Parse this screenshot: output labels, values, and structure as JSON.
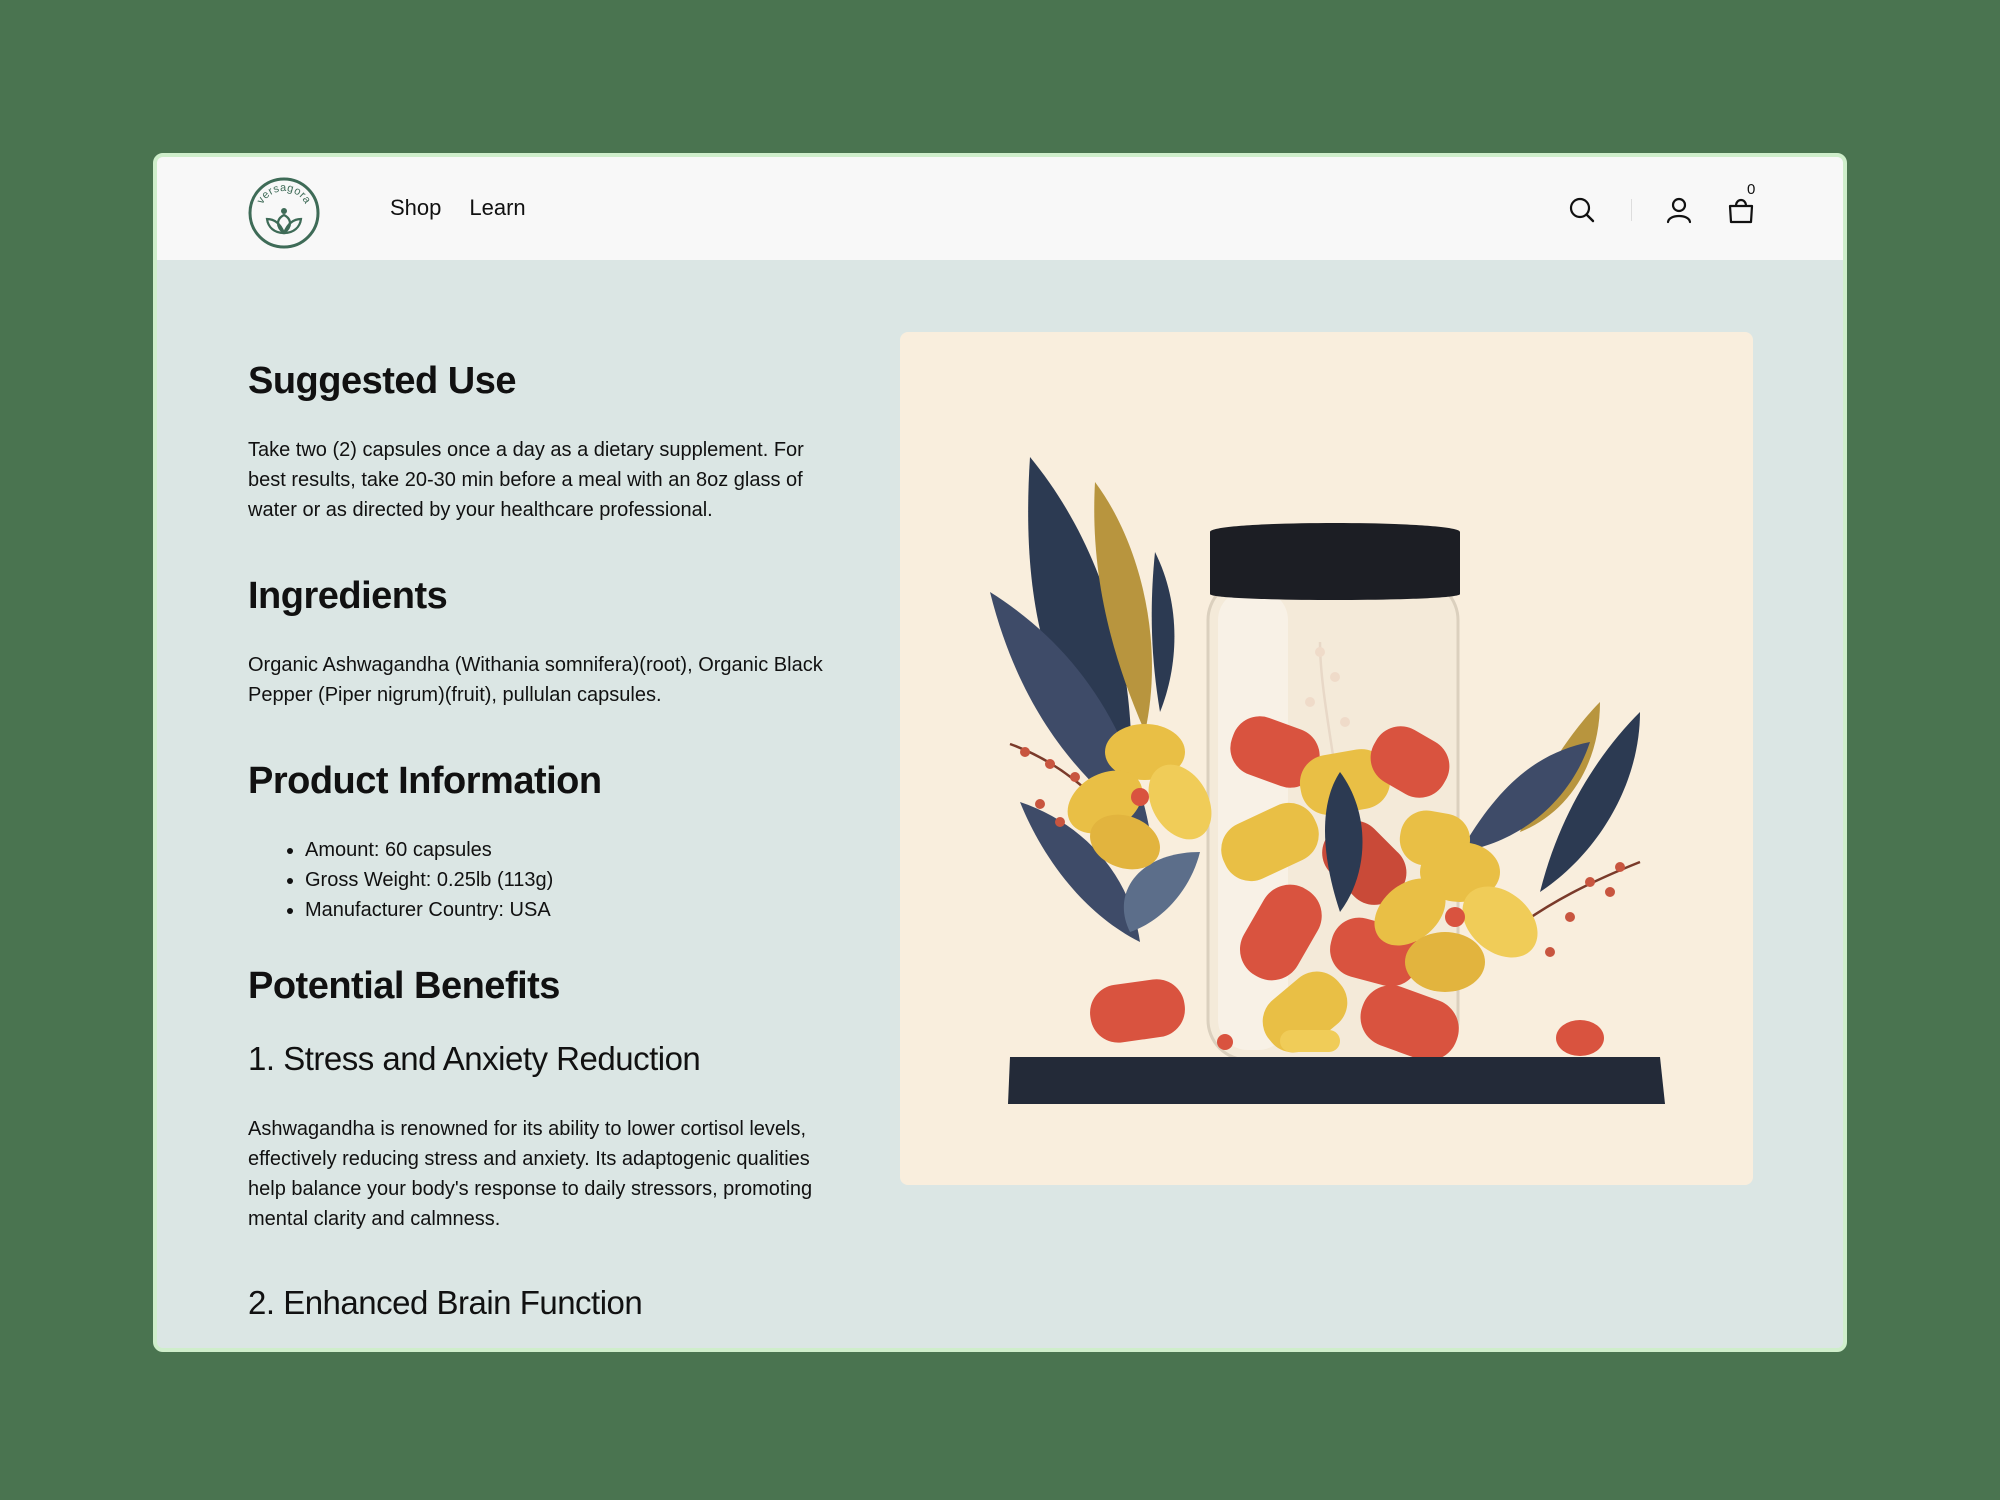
{
  "brand": {
    "name": "versagora"
  },
  "nav": {
    "shop": "Shop",
    "learn": "Learn"
  },
  "header": {
    "cart_count": "0"
  },
  "sections": {
    "suggested_use": {
      "title": "Suggested Use",
      "text": "Take two (2) capsules once a day as a dietary supplement. For best results, take 20-30 min before a meal with an 8oz glass of water or as directed by your healthcare professional."
    },
    "ingredients": {
      "title": "Ingredients",
      "text": "Organic Ashwagandha (Withania somnifera)(root), Organic Black Pepper (Piper nigrum)(fruit), pullulan capsules."
    },
    "product_information": {
      "title": "Product Information",
      "items": [
        {
          "label": "Amount:",
          "value": " 60 capsules"
        },
        {
          "label": "Gross Weight:",
          "value": " 0.25lb (113g)"
        },
        {
          "label": "Manufacturer Country:",
          "value": " USA"
        }
      ]
    },
    "potential_benefits": {
      "title": "Potential Benefits",
      "benefits": [
        {
          "title": "1. Stress and Anxiety Reduction",
          "text": "Ashwagandha is renowned for its ability to lower cortisol levels, effectively reducing stress and anxiety. Its adaptogenic qualities help balance your body's response to daily stressors, promoting mental clarity and calmness."
        },
        {
          "title": "2. Enhanced Brain Function"
        }
      ]
    }
  },
  "colors": {
    "page_bg": "#4a7450",
    "content_bg": "#dbe6e4",
    "header_bg": "#f8f8f8",
    "brand_green": "#3e6b57",
    "image_bg": "#f9eedd",
    "capsule_red": "#d9533f",
    "capsule_yellow": "#e9bf45",
    "leaf_navy": "#2c3a52",
    "cap_black": "#1c1e24"
  },
  "icons": [
    "search-icon",
    "user-icon",
    "bag-icon"
  ]
}
